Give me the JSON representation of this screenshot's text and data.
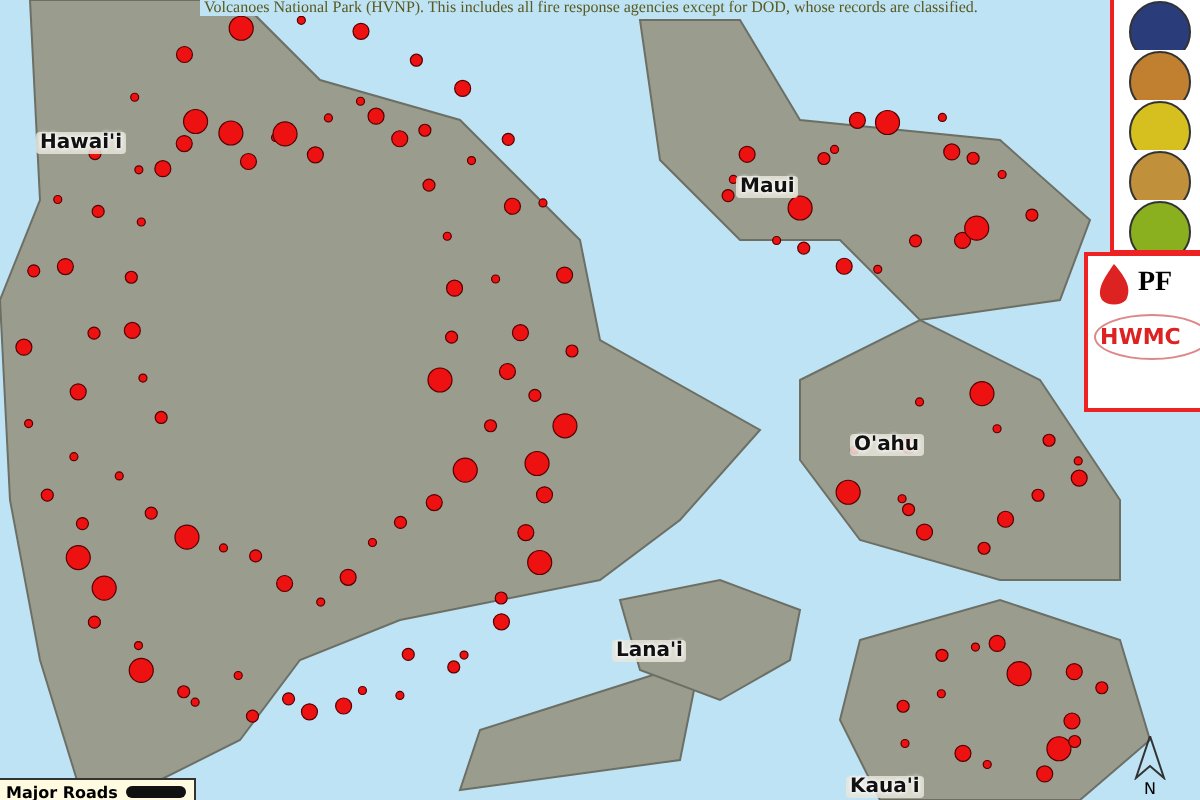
{
  "caption": "Volcanoes National Park (HVNP). This includes all fire response agencies except for DOD, whose records are classified.",
  "map": {
    "labels": [
      {
        "text": "Hawai'i"
      },
      {
        "text": "Maui"
      },
      {
        "text": "O'ahu"
      },
      {
        "text": "Lana'i"
      },
      {
        "text": "Kaua'i"
      }
    ],
    "legend": {
      "label": "Major Roads"
    },
    "north": "N"
  },
  "logos": {
    "pf": "PF",
    "hwmc": "HWMC"
  }
}
